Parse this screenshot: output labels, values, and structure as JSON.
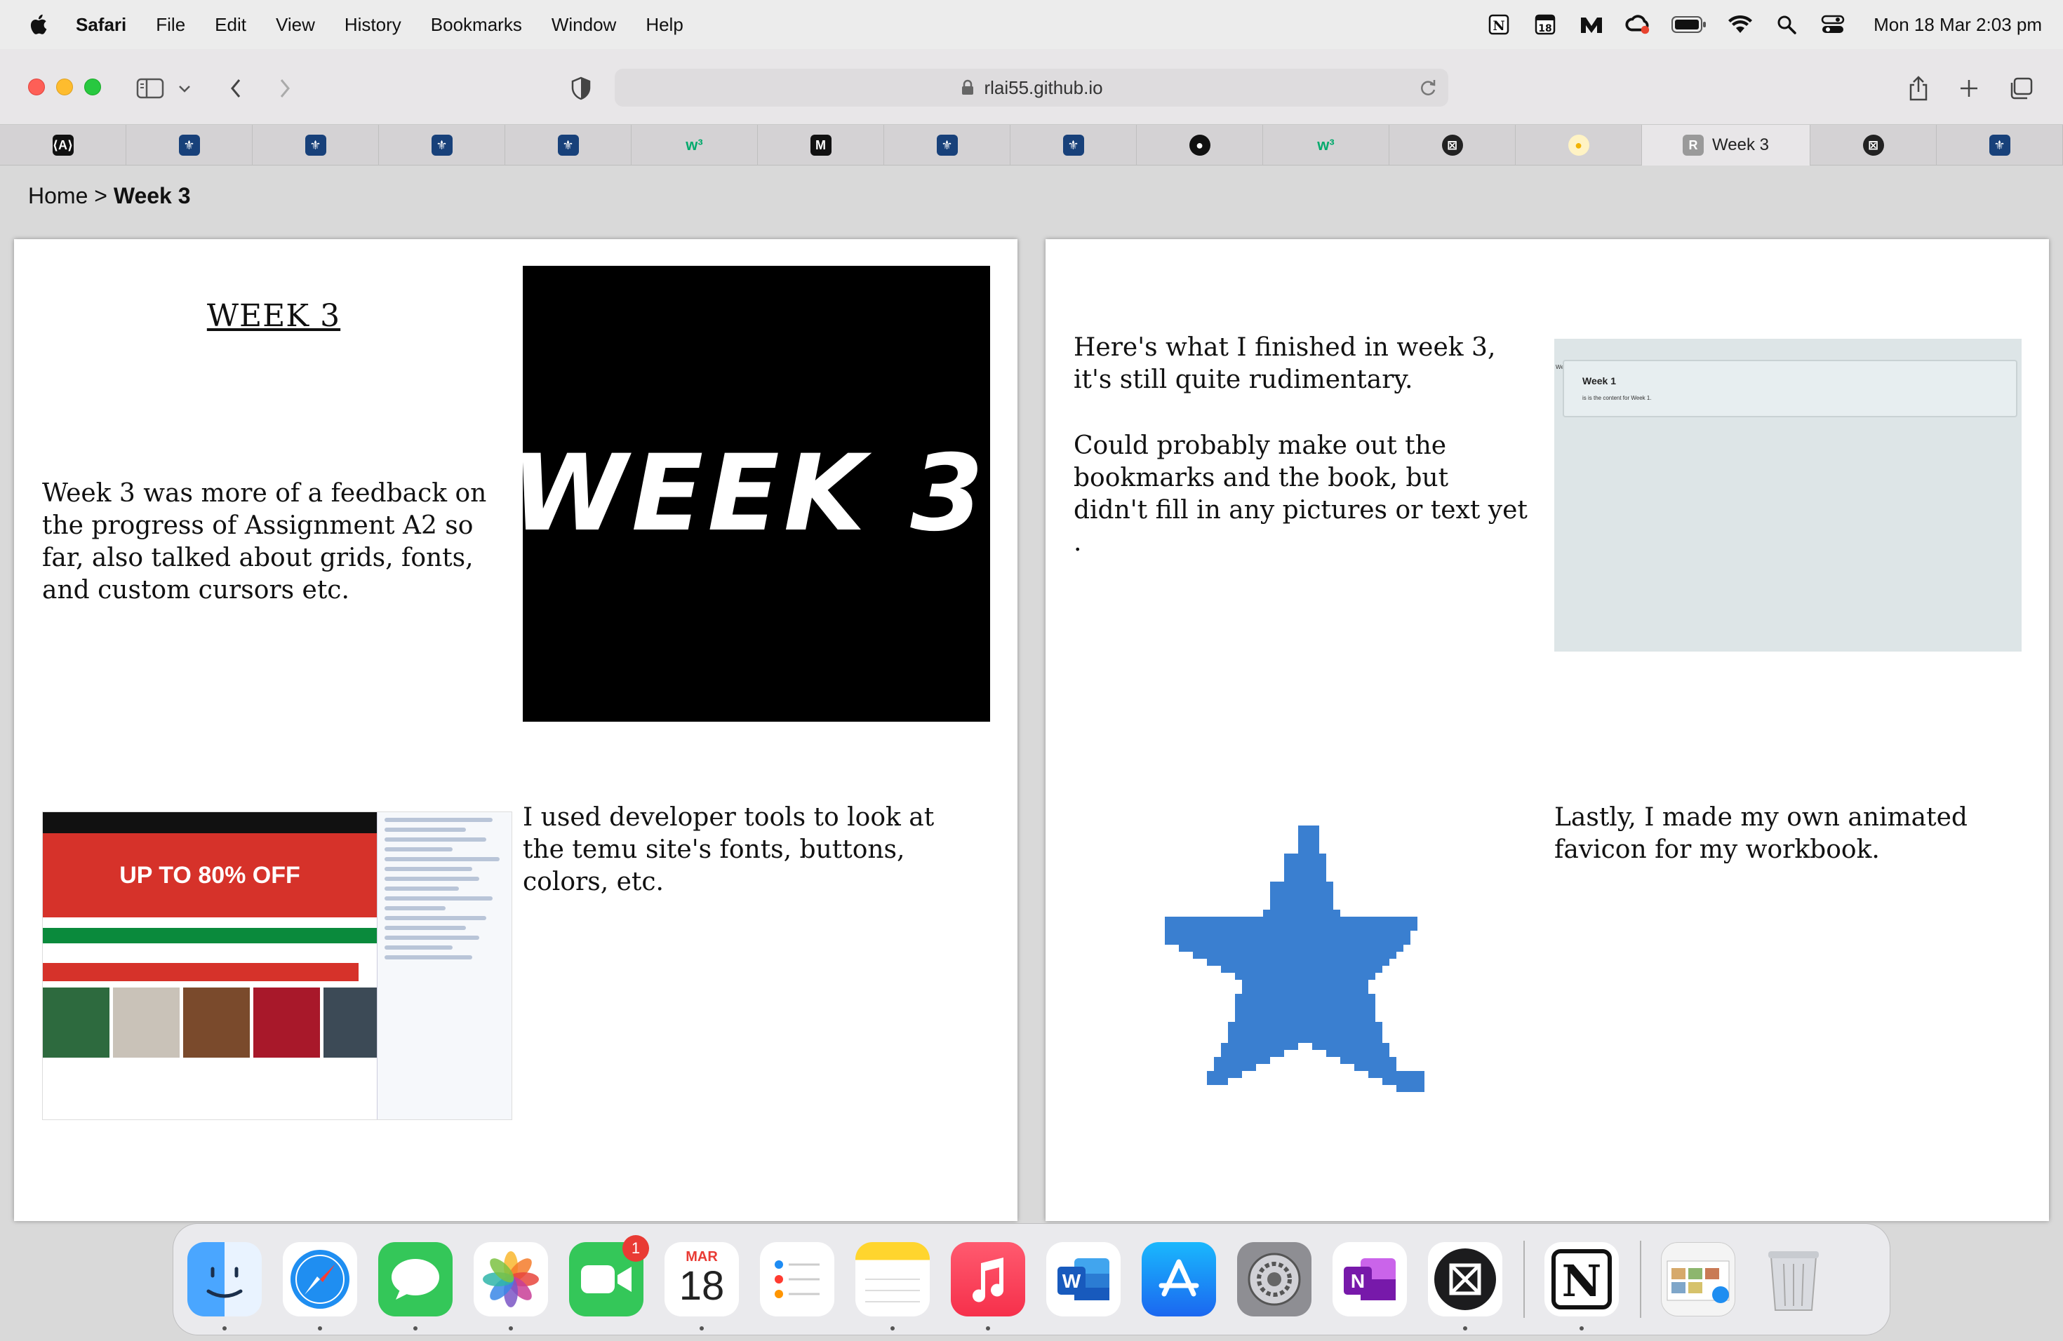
{
  "menubar": {
    "items": [
      "Safari",
      "File",
      "Edit",
      "View",
      "History",
      "Bookmarks",
      "Window",
      "Help"
    ],
    "clock": "Mon 18 Mar  2:03 pm",
    "status_icons": [
      "notion-icon",
      "calendar-18-icon",
      "mail-icon",
      "creative-cloud-icon",
      "battery-icon",
      "wifi-icon",
      "search-icon",
      "control-center-icon"
    ],
    "calendar_icon_text": "18"
  },
  "browser": {
    "url": "rlai55.github.io",
    "active_tab_label": "Week 3",
    "active_tab_favicon": "R",
    "tab_favicons": [
      "code-icon",
      "uni-icon",
      "uni-icon",
      "uni-icon",
      "uni-icon",
      "w3schools-icon",
      "m-icon",
      "uni-icon",
      "uni-icon",
      "github-icon",
      "w3schools-icon",
      "x-circle-icon",
      "egg-icon",
      "R",
      "x-circle-icon",
      "uni-icon"
    ]
  },
  "page": {
    "breadcrumb_home": "Home",
    "breadcrumb_sep": " > ",
    "breadcrumb_current": "Week 3",
    "left_panel": {
      "title": "WEEK 3",
      "intro": "Week 3 was more of a feedback on the progress of Assignment A2 so far, also talked about grids, fonts, and custom cursors etc.",
      "image_text": "WEEK 3",
      "devtools_text": "I used developer tools to look at the temu site's fonts, buttons, colors, etc.",
      "temu_hero_text": "UP TO 80% OFF"
    },
    "right_panel": {
      "progress_text_1": "Here's what I finished in week 3, it's still quite rudimentary.",
      "progress_text_2": "Could probably make out the bookmarks and the book, but didn't fill in any pictures or text yet .",
      "screenshot_card_title": "Week 1",
      "screenshot_card_sub": "is is the content for Week 1.",
      "screenshot_tiny": "Week 1",
      "favicon_text": "Lastly, I made my own animated favicon for my workbook."
    }
  },
  "dock": {
    "apps": [
      "Finder",
      "Safari",
      "Messages",
      "Photos",
      "FaceTime",
      "Calendar",
      "Reminders",
      "Notes",
      "Music",
      "Word",
      "App Store",
      "System Settings",
      "OneNote",
      "Perplexity",
      "Notion",
      "Preview",
      "Trash"
    ],
    "facetime_badge": "1",
    "calendar_month": "MAR",
    "calendar_day": "18",
    "word_letter": "W",
    "onenote_letter": "N",
    "notion_letter": "N"
  }
}
